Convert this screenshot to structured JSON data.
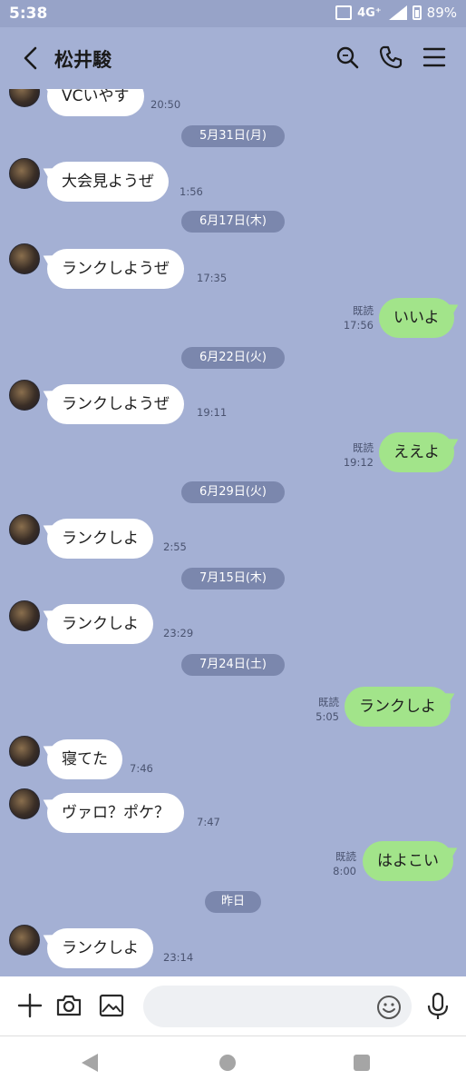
{
  "status_bar": {
    "time": "5:38",
    "network": "4G⁺",
    "battery": "89%"
  },
  "header": {
    "title": "松井駿"
  },
  "colors": {
    "background": "#a4b0d4",
    "incoming_bubble": "#ffffff",
    "outgoing_bubble": "#a2e48a",
    "date_pill": "#6e7aa0"
  },
  "messages": [
    {
      "side": "in",
      "text": "VCいやす",
      "time": "20:50"
    },
    {
      "date": "5月31日(月)"
    },
    {
      "side": "in",
      "text": "大会見ようぜ",
      "time": "1:56"
    },
    {
      "date": "6月17日(木)"
    },
    {
      "side": "in",
      "text": "ランクしようぜ",
      "time": "17:35"
    },
    {
      "side": "out",
      "text": "いいよ",
      "read": "既読",
      "time": "17:56"
    },
    {
      "date": "6月22日(火)"
    },
    {
      "side": "in",
      "text": "ランクしようぜ",
      "time": "19:11"
    },
    {
      "side": "out",
      "text": "ええよ",
      "read": "既読",
      "time": "19:12"
    },
    {
      "date": "6月29日(火)"
    },
    {
      "side": "in",
      "text": "ランクしよ",
      "time": "2:55"
    },
    {
      "date": "7月15日(木)"
    },
    {
      "side": "in",
      "text": "ランクしよ",
      "time": "23:29"
    },
    {
      "date": "7月24日(土)"
    },
    {
      "side": "out",
      "text": "ランクしよ",
      "read": "既読",
      "time": "5:05"
    },
    {
      "side": "in",
      "text": "寝てた",
      "time": "7:46"
    },
    {
      "side": "in",
      "text": "ヴァロ？ポケ？",
      "time": "7:47"
    },
    {
      "side": "out",
      "text": "はよこい",
      "read": "既読",
      "time": "8:00"
    },
    {
      "date": "昨日"
    },
    {
      "side": "in",
      "text": "ランクしよ",
      "time": "23:14"
    }
  ],
  "input": {
    "placeholder": ""
  }
}
